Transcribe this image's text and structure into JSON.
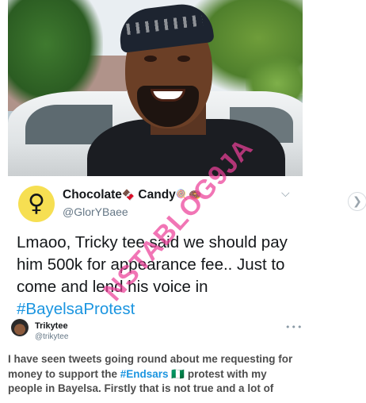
{
  "tweet": {
    "display_name": "Chocolate",
    "display_name_emoji_1": "🍫",
    "display_name_2": " Candy",
    "display_name_emoji_2": "🍭🍩",
    "handle": "@GlorYBaee",
    "avatar_icon": "female-fist-icon",
    "text_part1": "Lmaoo, Tricky tee said we should pay him 500k for appearance fee.. Just to come and lend his voice in ",
    "hashtag": "#BayelsaProtest"
  },
  "embedded_tweet": {
    "display_name": "Trikytee",
    "handle": "@trikytee",
    "more": "•••",
    "text_part1": "I have seen tweets going round about me requesting for money to support the ",
    "hashtag": "#Endsars",
    "flag": "🇳🇬",
    "text_part2": " protest with my people in Bayelsa. Firstly that is not true and a lot of"
  },
  "watermark": "NSTABLOG9JA",
  "colors": {
    "link": "#1b95e0",
    "watermark": "#ec4098",
    "avatar_bg": "#f6df52"
  }
}
